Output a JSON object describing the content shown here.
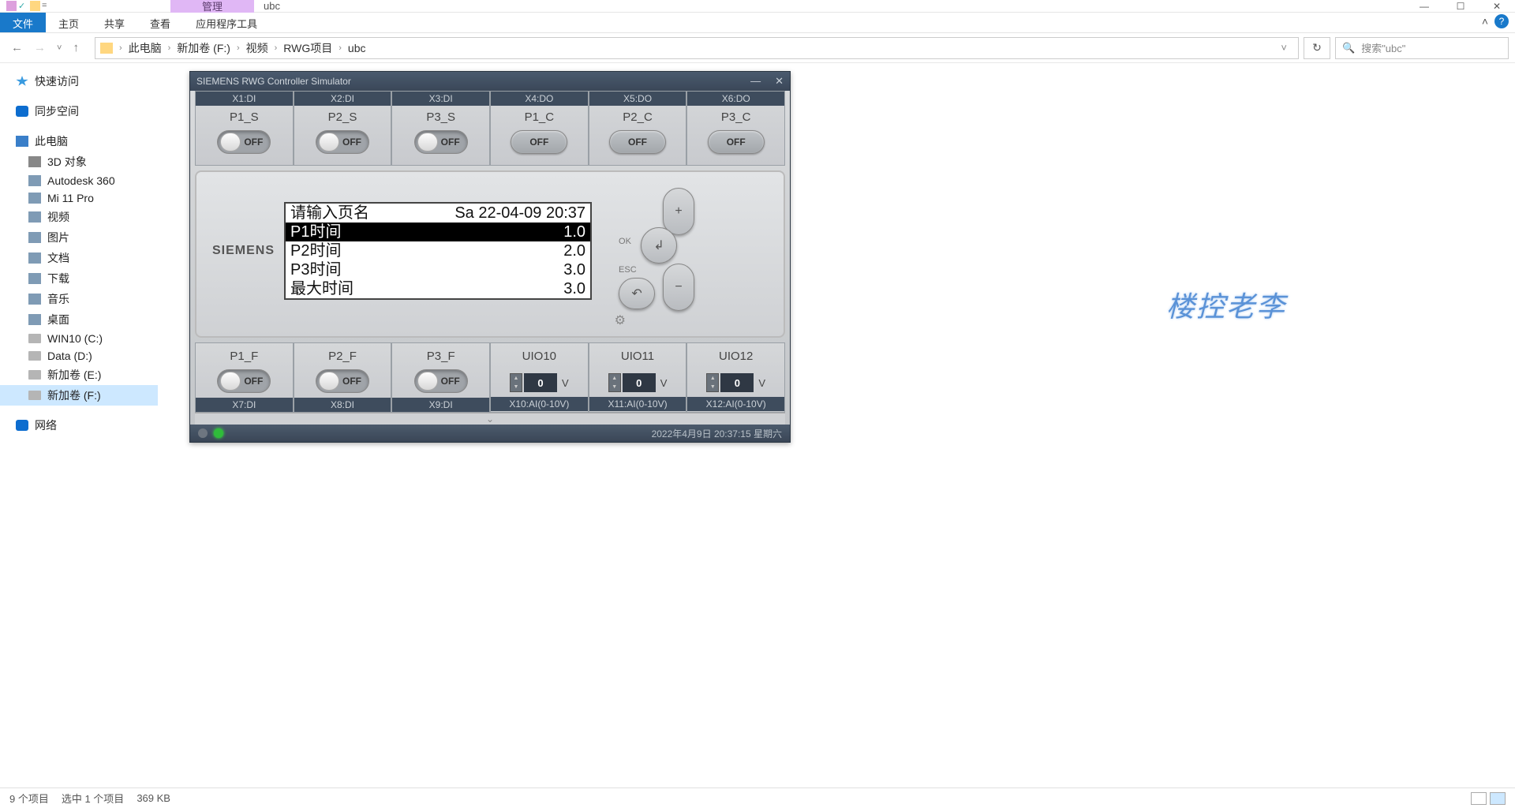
{
  "window": {
    "context_tab": "管理",
    "title": "ubc",
    "min": "—",
    "max": "☐",
    "close": "✕"
  },
  "ribbon": {
    "file": "文件",
    "tabs": [
      "主页",
      "共享",
      "查看",
      "应用程序工具"
    ],
    "chevron": "˄"
  },
  "nav": {
    "back": "←",
    "forward": "→",
    "dropdown": "˅",
    "up": "↑",
    "crumbs": [
      "此电脑",
      "新加卷 (F:)",
      "视频",
      "RWG项目",
      "ubc"
    ],
    "sep": "›",
    "history": "˅",
    "refresh": "↻",
    "search_placeholder": "搜索\"ubc\"",
    "search_icon": "🔍"
  },
  "sidebar": {
    "quick": "快速访问",
    "sync": "同步空间",
    "pc": "此电脑",
    "pc_children": [
      "3D 对象",
      "Autodesk 360",
      "Mi 11 Pro",
      "视频",
      "图片",
      "文档",
      "下载",
      "音乐",
      "桌面",
      "WIN10 (C:)",
      "Data (D:)",
      "新加卷 (E:)",
      "新加卷 (F:)"
    ],
    "network": "网络"
  },
  "sim": {
    "title": "SIEMENS RWG Controller Simulator",
    "min": "—",
    "close": "✕",
    "top_ports": [
      "X1:DI",
      "X2:DI",
      "X3:DI",
      "X4:DO",
      "X5:DO",
      "X6:DO"
    ],
    "top_labels": [
      "P1_S",
      "P2_S",
      "P3_S",
      "P1_C",
      "P2_C",
      "P3_C"
    ],
    "toggle_state": "OFF",
    "btn_state": "OFF",
    "logo": "SIEMENS",
    "lcd": {
      "title": "请输入页名",
      "datetime": "Sa 22-04-09 20:37",
      "rows": [
        {
          "label": "P1时间",
          "value": "1.0",
          "hl": true
        },
        {
          "label": "P2时间",
          "value": "2.0",
          "hl": false
        },
        {
          "label": "P3时间",
          "value": "3.0",
          "hl": false
        },
        {
          "label": "最大时间",
          "value": "3.0",
          "hl": false
        }
      ]
    },
    "dpad": {
      "up": "+",
      "down": "−",
      "ok": "↲",
      "esc": "↶",
      "ok_label": "OK",
      "esc_label": "ESC"
    },
    "bottom_labels": [
      "P1_F",
      "P2_F",
      "P3_F",
      "UIO10",
      "UIO11",
      "UIO12"
    ],
    "bottom_ports": [
      "X7:DI",
      "X8:DI",
      "X9:DI",
      "X10:AI(0-10V)",
      "X11:AI(0-10V)",
      "X12:AI(0-10V)"
    ],
    "spinner_value": "0",
    "spinner_unit": "V",
    "status_ts": "2022年4月9日 20:37:15 星期六"
  },
  "watermark": "楼控老李",
  "statusbar": {
    "items": "9 个项目",
    "selected": "选中 1 个项目",
    "size": "369 KB"
  }
}
